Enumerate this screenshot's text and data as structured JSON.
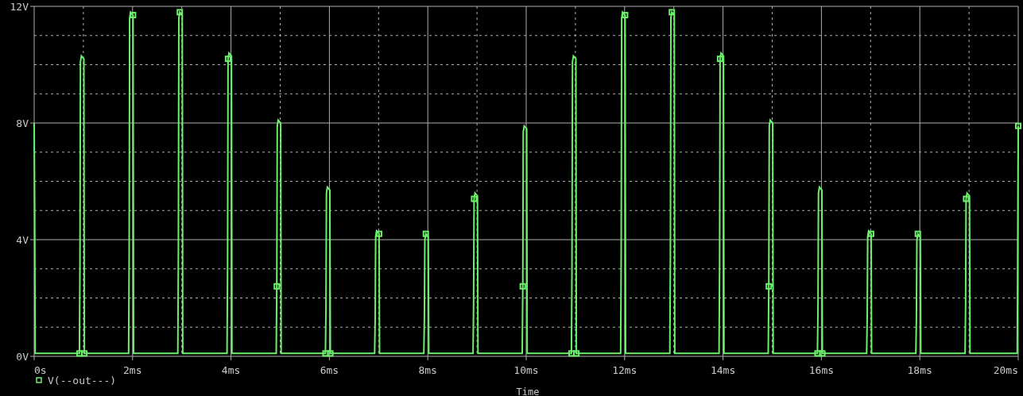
{
  "plot": {
    "chart_data": {
      "type": "line",
      "grid": true,
      "xlabel": "Time",
      "xlim": [
        0,
        20
      ],
      "ylim": [
        0,
        12
      ],
      "xticks": [
        {
          "value": 0,
          "label": "0s"
        },
        {
          "value": 2,
          "label": "2ms"
        },
        {
          "value": 4,
          "label": "4ms"
        },
        {
          "value": 6,
          "label": "6ms"
        },
        {
          "value": 8,
          "label": "8ms"
        },
        {
          "value": 10,
          "label": "10ms"
        },
        {
          "value": 12,
          "label": "12ms"
        },
        {
          "value": 14,
          "label": "14ms"
        },
        {
          "value": 16,
          "label": "16ms"
        },
        {
          "value": 18,
          "label": "18ms"
        },
        {
          "value": 20,
          "label": "20ms"
        }
      ],
      "yticks": [
        {
          "value": 0,
          "label": "0V"
        },
        {
          "value": 4,
          "label": "4V"
        },
        {
          "value": 8,
          "label": "8V"
        },
        {
          "value": 12,
          "label": "12V"
        }
      ],
      "x": [
        0,
        0.01,
        0.02,
        0.92,
        0.93,
        0.94,
        0.96,
        1.01,
        1.02,
        1.92,
        1.93,
        1.94,
        1.96,
        2.01,
        2.02,
        2.92,
        2.93,
        2.94,
        2.96,
        3.01,
        3.02,
        3.92,
        3.93,
        3.94,
        3.96,
        4.01,
        4.02,
        4.92,
        4.93,
        4.94,
        4.96,
        5.01,
        5.02,
        5.92,
        5.93,
        5.94,
        5.96,
        6.01,
        6.02,
        6.92,
        6.93,
        6.94,
        6.96,
        7.01,
        7.02,
        7.92,
        7.93,
        7.94,
        7.96,
        8.01,
        8.02,
        8.92,
        8.93,
        8.94,
        8.96,
        9.01,
        9.02,
        9.92,
        9.93,
        9.94,
        9.96,
        10.01,
        10.02,
        10.92,
        10.93,
        10.94,
        10.96,
        11.01,
        11.02,
        11.92,
        11.93,
        11.94,
        11.96,
        12.01,
        12.02,
        12.92,
        12.93,
        12.94,
        12.96,
        13.01,
        13.02,
        13.92,
        13.93,
        13.94,
        13.96,
        14.01,
        14.02,
        14.92,
        14.93,
        14.94,
        14.96,
        15.01,
        15.02,
        15.92,
        15.93,
        15.94,
        15.96,
        16.01,
        16.02,
        16.92,
        16.93,
        16.94,
        16.96,
        17.01,
        17.02,
        17.92,
        17.93,
        17.94,
        17.96,
        18.01,
        18.02,
        18.92,
        18.93,
        18.94,
        18.96,
        19.01,
        19.02,
        19.98,
        20
      ],
      "series": [
        {
          "name": "V(--out---)",
          "color": "#6cf06c",
          "values": [
            8.0,
            5.2,
            0.1,
            0.1,
            3.1,
            10.1,
            10.3,
            10.2,
            0.1,
            0.1,
            3.5,
            11.6,
            11.8,
            11.7,
            0.1,
            0.1,
            3.5,
            11.6,
            11.8,
            11.7,
            0.1,
            0.1,
            3.1,
            10.2,
            10.4,
            10.3,
            0.1,
            0.1,
            2.4,
            7.9,
            8.1,
            8.0,
            0.1,
            0.1,
            1.7,
            5.6,
            5.8,
            5.7,
            0.1,
            0.1,
            1.3,
            4.1,
            4.3,
            4.2,
            0.1,
            0.1,
            1.3,
            4.0,
            4.2,
            4.1,
            0.1,
            0.1,
            1.7,
            5.4,
            5.6,
            5.5,
            0.1,
            0.1,
            2.4,
            7.7,
            7.9,
            7.8,
            0.1,
            0.1,
            3.1,
            10.1,
            10.3,
            10.2,
            0.1,
            0.1,
            3.5,
            11.6,
            11.8,
            11.7,
            0.1,
            0.1,
            3.5,
            11.6,
            11.8,
            11.7,
            0.1,
            0.1,
            3.1,
            10.2,
            10.4,
            10.3,
            0.1,
            0.1,
            2.4,
            7.9,
            8.1,
            8.0,
            0.1,
            0.1,
            1.7,
            5.6,
            5.8,
            5.7,
            0.1,
            0.1,
            1.3,
            4.1,
            4.3,
            4.2,
            0.1,
            0.1,
            1.3,
            4.0,
            4.2,
            4.1,
            0.1,
            0.1,
            1.7,
            5.4,
            5.6,
            5.5,
            0.1,
            0.1,
            7.9
          ]
        }
      ]
    }
  }
}
